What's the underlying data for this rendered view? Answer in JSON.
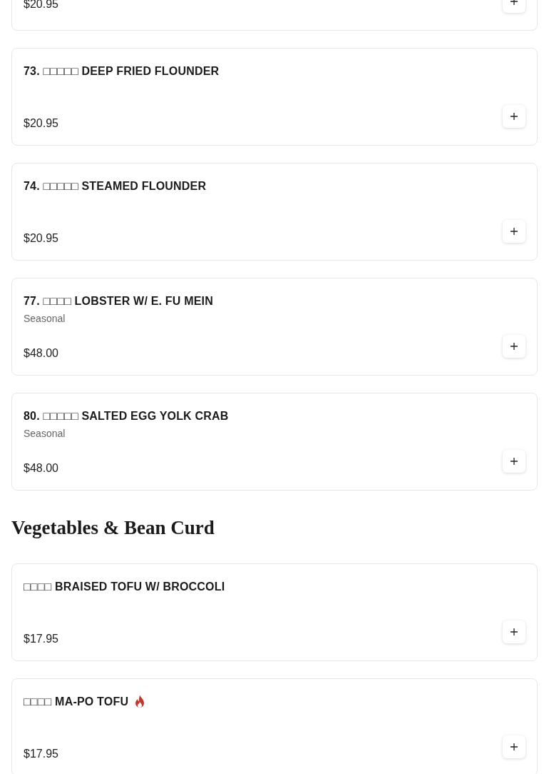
{
  "sections": [
    {
      "items": [
        {
          "price": "$20.95"
        },
        {
          "title": "73. □□□□□ DEEP FRIED FLOUNDER",
          "price": "$20.95",
          "spicy": false
        },
        {
          "title": "74. □□□□□ STEAMED FLOUNDER",
          "price": "$20.95",
          "spicy": false
        },
        {
          "title": "77. □□□□ LOBSTER W/ E. FU MEIN",
          "description": "Seasonal",
          "price": "$48.00",
          "spicy": false
        },
        {
          "title": "80. □□□□□ SALTED EGG YOLK CRAB",
          "description": "Seasonal",
          "price": "$48.00",
          "spicy": false
        }
      ]
    },
    {
      "heading": "Vegetables & Bean Curd",
      "items": [
        {
          "title": "□□□□ BRAISED TOFU W/ BROCCOLI",
          "price": "$17.95",
          "spicy": false
        },
        {
          "title": "□□□□ MA-PO TOFU",
          "price": "$17.95",
          "spicy": true
        }
      ]
    }
  ]
}
